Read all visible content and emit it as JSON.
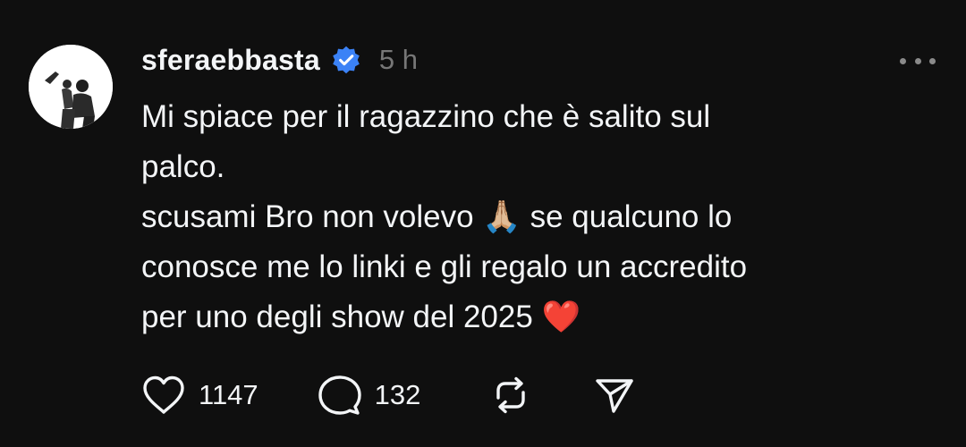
{
  "post": {
    "username": "sferaebbasta",
    "timestamp": "5 h",
    "verified_color": "#3b82f6",
    "text_lines": [
      "Mi spiace per il ragazzino che è salito sul",
      "palco."
    ],
    "line3_before": "scusami Bro non volevo ",
    "line3_emoji": "🙏🏼",
    "line3_after": " se qualcuno lo",
    "line4": "conosce me lo linki e gli regalo un accredito",
    "line5_text": "per uno degli show del 2025 ",
    "line5_emoji": "❤️",
    "heart_emoji_color": "#e0243b",
    "likes": "1147",
    "replies": "132"
  }
}
